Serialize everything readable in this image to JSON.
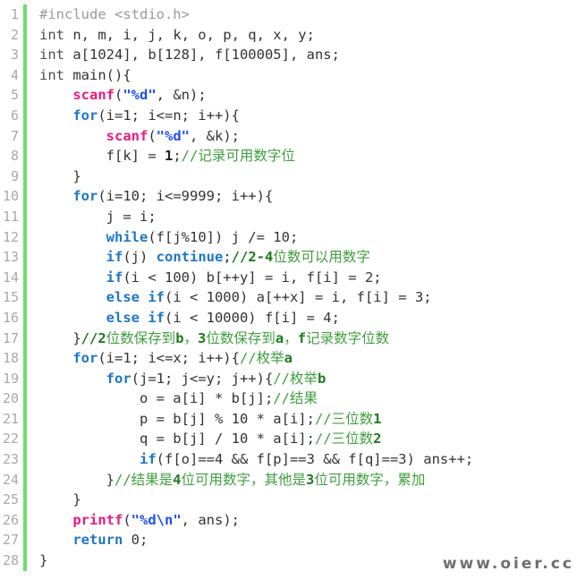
{
  "editor": {
    "language": "c",
    "gutter_accent_color": "#6bdf6b",
    "background_color": "#ffffff",
    "line_number_color": "#a9a9a9",
    "total_lines": 28,
    "colors": {
      "keyword": "#1f77c4",
      "function": "#ec1a79",
      "string": "#1b4ff0",
      "comment": "#3f9e3f",
      "preprocessor": "#9a9a9a",
      "plain": "#333333"
    }
  },
  "watermark": {
    "text": "www.oier.cc"
  },
  "lines": [
    {
      "n": "1",
      "tokens": [
        {
          "c": "t-pre",
          "t": "#include <stdio.h>"
        }
      ]
    },
    {
      "n": "2",
      "tokens": [
        {
          "c": "t-plain",
          "t": "int"
        },
        {
          "c": "t-op",
          "t": " n, m, i, j, k, o, p, q, x, y;"
        }
      ]
    },
    {
      "n": "3",
      "tokens": [
        {
          "c": "t-plain",
          "t": "int"
        },
        {
          "c": "t-op",
          "t": " a[1024], b[128], f[100005], ans;"
        }
      ]
    },
    {
      "n": "4",
      "tokens": [
        {
          "c": "t-plain",
          "t": "int"
        },
        {
          "c": "t-op",
          "t": " main(){"
        }
      ]
    },
    {
      "n": "5",
      "tokens": [
        {
          "c": "t-op",
          "t": "    "
        },
        {
          "c": "t-fn",
          "t": "scanf"
        },
        {
          "c": "t-op",
          "t": "("
        },
        {
          "c": "t-str",
          "t": "\"%d\""
        },
        {
          "c": "t-op",
          "t": ", &n);"
        }
      ]
    },
    {
      "n": "6",
      "tokens": [
        {
          "c": "t-op",
          "t": "    "
        },
        {
          "c": "t-kw",
          "t": "for"
        },
        {
          "c": "t-op",
          "t": "(i=1; i<=n; i++){"
        }
      ]
    },
    {
      "n": "7",
      "tokens": [
        {
          "c": "t-op",
          "t": "        "
        },
        {
          "c": "t-fn",
          "t": "scanf"
        },
        {
          "c": "t-op",
          "t": "("
        },
        {
          "c": "t-str",
          "t": "\"%d\""
        },
        {
          "c": "t-op",
          "t": ", &k);"
        }
      ]
    },
    {
      "n": "8",
      "tokens": [
        {
          "c": "t-op",
          "t": "        f[k] = "
        },
        {
          "c": "t-num",
          "t": "1"
        },
        {
          "c": "t-op",
          "t": ";"
        },
        {
          "c": "t-comment",
          "t": "//记录可用数字位"
        }
      ]
    },
    {
      "n": "9",
      "tokens": [
        {
          "c": "t-op",
          "t": "    }"
        }
      ]
    },
    {
      "n": "10",
      "tokens": [
        {
          "c": "t-op",
          "t": "    "
        },
        {
          "c": "t-kw",
          "t": "for"
        },
        {
          "c": "t-op",
          "t": "(i=10; i<=9999; i++){"
        }
      ]
    },
    {
      "n": "11",
      "tokens": [
        {
          "c": "t-op",
          "t": "        j = i;"
        }
      ]
    },
    {
      "n": "12",
      "tokens": [
        {
          "c": "t-op",
          "t": "        "
        },
        {
          "c": "t-kw",
          "t": "while"
        },
        {
          "c": "t-op",
          "t": "(f[j%10]) j /= 10;"
        }
      ]
    },
    {
      "n": "13",
      "tokens": [
        {
          "c": "t-op",
          "t": "        "
        },
        {
          "c": "t-kw",
          "t": "if"
        },
        {
          "c": "t-op",
          "t": "(j) "
        },
        {
          "c": "t-kw",
          "t": "continue"
        },
        {
          "c": "t-op",
          "t": ";"
        },
        {
          "c": "t-comment-b",
          "t": "//2-4"
        },
        {
          "c": "t-comment",
          "t": "位数可以用数字"
        }
      ]
    },
    {
      "n": "14",
      "tokens": [
        {
          "c": "t-op",
          "t": "        "
        },
        {
          "c": "t-kw",
          "t": "if"
        },
        {
          "c": "t-op",
          "t": "(i < 100) b[++y] = i, f[i] = 2;"
        }
      ]
    },
    {
      "n": "15",
      "tokens": [
        {
          "c": "t-op",
          "t": "        "
        },
        {
          "c": "t-kw",
          "t": "else if"
        },
        {
          "c": "t-op",
          "t": "(i < 1000) a[++x] = i, f[i] = 3;"
        }
      ]
    },
    {
      "n": "16",
      "tokens": [
        {
          "c": "t-op",
          "t": "        "
        },
        {
          "c": "t-kw",
          "t": "else if"
        },
        {
          "c": "t-op",
          "t": "(i < 10000) f[i] = 4;"
        }
      ]
    },
    {
      "n": "17",
      "tokens": [
        {
          "c": "t-op",
          "t": "    }"
        },
        {
          "c": "t-comment-b",
          "t": "//2"
        },
        {
          "c": "t-comment",
          "t": "位数保存到"
        },
        {
          "c": "t-comment-b",
          "t": "b"
        },
        {
          "c": "t-comment",
          "t": "，"
        },
        {
          "c": "t-comment-b",
          "t": "3"
        },
        {
          "c": "t-comment",
          "t": "位数保存到"
        },
        {
          "c": "t-comment-b",
          "t": "a"
        },
        {
          "c": "t-comment",
          "t": "，"
        },
        {
          "c": "t-comment-b",
          "t": "f"
        },
        {
          "c": "t-comment",
          "t": "记录数字位数"
        }
      ]
    },
    {
      "n": "18",
      "tokens": [
        {
          "c": "t-op",
          "t": "    "
        },
        {
          "c": "t-kw",
          "t": "for"
        },
        {
          "c": "t-op",
          "t": "(i=1; i<=x; i++){"
        },
        {
          "c": "t-comment",
          "t": "//枚举"
        },
        {
          "c": "t-comment-b",
          "t": "a"
        }
      ]
    },
    {
      "n": "19",
      "tokens": [
        {
          "c": "t-op",
          "t": "        "
        },
        {
          "c": "t-kw",
          "t": "for"
        },
        {
          "c": "t-op",
          "t": "(j=1; j<=y; j++){"
        },
        {
          "c": "t-comment",
          "t": "//枚举"
        },
        {
          "c": "t-comment-b",
          "t": "b"
        }
      ]
    },
    {
      "n": "20",
      "tokens": [
        {
          "c": "t-op",
          "t": "            o = a[i] * b[j];"
        },
        {
          "c": "t-comment",
          "t": "//结果"
        }
      ]
    },
    {
      "n": "21",
      "tokens": [
        {
          "c": "t-op",
          "t": "            p = b[j] % 10 * a[i];"
        },
        {
          "c": "t-comment",
          "t": "//三位数"
        },
        {
          "c": "t-comment-b",
          "t": "1"
        }
      ]
    },
    {
      "n": "22",
      "tokens": [
        {
          "c": "t-op",
          "t": "            q = b[j] / 10 * a[i];"
        },
        {
          "c": "t-comment",
          "t": "//三位数"
        },
        {
          "c": "t-comment-b",
          "t": "2"
        }
      ]
    },
    {
      "n": "23",
      "tokens": [
        {
          "c": "t-op",
          "t": "            "
        },
        {
          "c": "t-kw",
          "t": "if"
        },
        {
          "c": "t-op",
          "t": "(f[o]==4 && f[p]==3 && f[q]==3) ans++;"
        }
      ]
    },
    {
      "n": "24",
      "tokens": [
        {
          "c": "t-op",
          "t": "        }"
        },
        {
          "c": "t-comment",
          "t": "//结果是"
        },
        {
          "c": "t-comment-b",
          "t": "4"
        },
        {
          "c": "t-comment",
          "t": "位可用数字，其他是"
        },
        {
          "c": "t-comment-b",
          "t": "3"
        },
        {
          "c": "t-comment",
          "t": "位可用数字，累加"
        }
      ]
    },
    {
      "n": "25",
      "tokens": [
        {
          "c": "t-op",
          "t": "    }"
        }
      ]
    },
    {
      "n": "26",
      "tokens": [
        {
          "c": "t-op",
          "t": "    "
        },
        {
          "c": "t-fn",
          "t": "printf"
        },
        {
          "c": "t-op",
          "t": "("
        },
        {
          "c": "t-str",
          "t": "\"%d\\n\""
        },
        {
          "c": "t-op",
          "t": ", ans);"
        }
      ]
    },
    {
      "n": "27",
      "tokens": [
        {
          "c": "t-op",
          "t": "    "
        },
        {
          "c": "t-kw",
          "t": "return"
        },
        {
          "c": "t-op",
          "t": " 0;"
        }
      ]
    },
    {
      "n": "28",
      "tokens": [
        {
          "c": "t-op",
          "t": "}"
        }
      ]
    }
  ]
}
